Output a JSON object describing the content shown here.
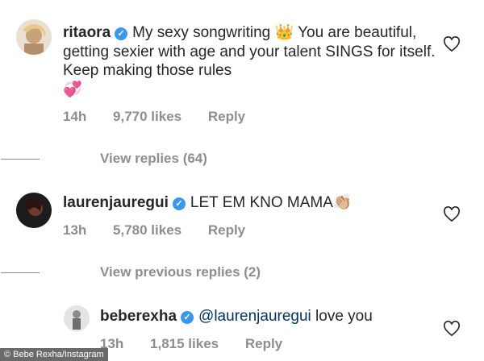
{
  "comments": [
    {
      "username": "ritaora",
      "text": "My sexy songwriting 👑 You are beautiful, getting sexier with age and your talent SINGS for itself. Keep making those rules",
      "emoji_end": "💞",
      "time": "14h",
      "likes": "9,770 likes",
      "reply": "Reply"
    },
    {
      "username": "laurenjauregui",
      "text": "LET EM KNO MAMA👏🏼",
      "time": "13h",
      "likes": "5,780 likes",
      "reply": "Reply"
    },
    {
      "username": "beberexha",
      "mention": "@laurenjauregui",
      "text": "love you",
      "time": "13h",
      "likes": "1,815 likes",
      "reply": "Reply"
    }
  ],
  "view_replies_1": "View replies (64)",
  "view_replies_2": "View previous replies (2)",
  "watermark": "© Bebe Rexha/Instagram",
  "colors": {
    "verified": "#3897f0",
    "meta": "#8e8e8e",
    "text": "#262626"
  }
}
